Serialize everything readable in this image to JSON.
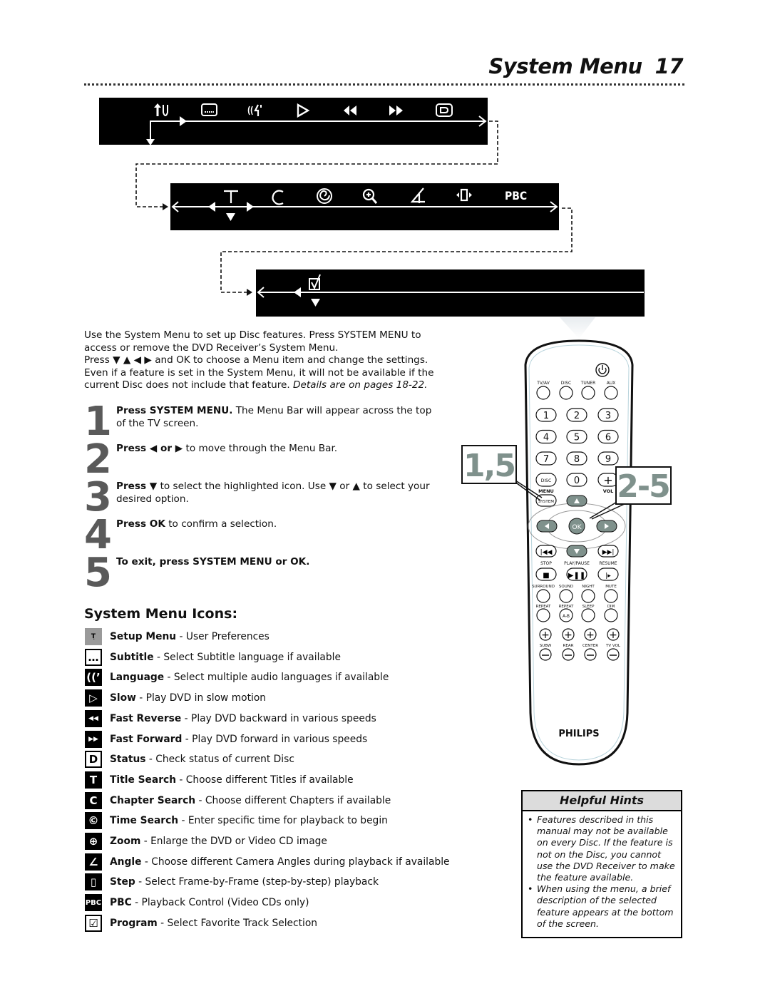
{
  "header": {
    "title": "System Menu",
    "page_number": "17"
  },
  "menu_bars": {
    "bar1": {
      "icons": [
        {
          "name": "setup-icon",
          "glyph": "Tͅ"
        },
        {
          "name": "subtitle-icon",
          "glyph": "▭"
        },
        {
          "name": "language-icon",
          "glyph": "((ᴴ"
        },
        {
          "name": "slow-icon",
          "glyph": "▷"
        },
        {
          "name": "fast-reverse-icon",
          "glyph": "◀◀"
        },
        {
          "name": "fast-forward-icon",
          "glyph": "▶▶"
        },
        {
          "name": "status-icon",
          "glyph": "D"
        }
      ]
    },
    "bar2": {
      "icons": [
        {
          "name": "title-search-icon",
          "glyph": "T"
        },
        {
          "name": "chapter-search-icon",
          "glyph": "C"
        },
        {
          "name": "time-search-icon",
          "glyph": "©"
        },
        {
          "name": "zoom-icon",
          "glyph": "⊕"
        },
        {
          "name": "angle-icon",
          "glyph": "∠"
        },
        {
          "name": "step-icon",
          "glyph": "◂▯▸"
        },
        {
          "name": "pbc-icon",
          "glyph": "PBC"
        }
      ]
    },
    "bar3": {
      "icons": [
        {
          "name": "program-icon",
          "glyph": "☑"
        }
      ]
    }
  },
  "intro": {
    "line1": "Use the System Menu to set up Disc features. Press SYSTEM MENU to access or remove the DVD Receiver’s System Menu.",
    "line2": "Press ▼ ▲ ◀ ▶ and OK to choose a Menu item and change the settings. Even if a feature is set in the System Menu, it will not be available if the current Disc does not include that feature.",
    "details": "Details are on pages 18-22."
  },
  "steps": [
    {
      "number": "1",
      "bold": "Press SYSTEM MENU.",
      "text": " The Menu Bar will appear across the top of the TV screen."
    },
    {
      "number": "2",
      "bold": "Press ◀ or ▶",
      "text": " to move through the Menu Bar."
    },
    {
      "number": "3",
      "bold": "Press ▼",
      "text": " to select the highlighted icon. Use ▼ or ▲  to select your desired option."
    },
    {
      "number": "4",
      "bold": "Press OK",
      "text": " to confirm a selection."
    },
    {
      "number": "5",
      "bold": "To exit, press SYSTEM MENU or OK.",
      "text": ""
    }
  ],
  "icons_section": {
    "title": "System Menu Icons:",
    "items": [
      {
        "glyph": "Tͅ",
        "name": "Setup Menu",
        "desc": " - User Preferences"
      },
      {
        "glyph": "…",
        "name": "Subtitle",
        "desc": " - Select Subtitle language if available"
      },
      {
        "glyph": "((’",
        "name": "Language",
        "desc": " - Select multiple audio languages if available"
      },
      {
        "glyph": "▷",
        "name": "Slow",
        "desc": " - Play DVD in slow motion"
      },
      {
        "glyph": "◀◀",
        "name": "Fast Reverse",
        "desc": " - Play DVD backward in various speeds"
      },
      {
        "glyph": "▶▶",
        "name": "Fast Forward",
        "desc": " - Play DVD forward in various speeds"
      },
      {
        "glyph": "D",
        "name": "Status",
        "desc": " - Check status of current Disc"
      },
      {
        "glyph": "T",
        "name": "Title Search",
        "desc": " - Choose different Titles if available"
      },
      {
        "glyph": "C",
        "name": "Chapter Search",
        "desc": " - Choose different Chapters if available"
      },
      {
        "glyph": "©",
        "name": "Time Search",
        "desc": " - Enter specific time for playback to begin"
      },
      {
        "glyph": "⊕",
        "name": "Zoom",
        "desc": " - Enlarge the DVD or Video CD image"
      },
      {
        "glyph": "∠",
        "name": "Angle",
        "desc": " - Choose different Camera Angles during playback if available"
      },
      {
        "glyph": "▯",
        "name": "Step",
        "desc": " - Select Frame-by-Frame (step-by-step) playback"
      },
      {
        "glyph": "PBC",
        "name": "PBC",
        "desc": " - Playback Control (Video CDs only)"
      },
      {
        "glyph": "☑",
        "name": "Program",
        "desc": " - Select Favorite Track Selection"
      }
    ]
  },
  "remote": {
    "brand": "PHILIPS",
    "source_labels": [
      "TV/AV",
      "DISC",
      "TUNER",
      "AUX"
    ],
    "digits": [
      "1",
      "2",
      "3",
      "4",
      "5",
      "6",
      "7",
      "8",
      "9",
      "0"
    ],
    "disc_menu": "DISC",
    "menu": "MENU",
    "system": "SYSTEM",
    "vol": "VOL",
    "ok": "OK",
    "transport_labels": [
      "STOP",
      "PLAY/PAUSE",
      "RESUME"
    ],
    "row_labels_1": [
      "SURROUND",
      "SOUND",
      "NIGHT",
      "MUTE"
    ],
    "row_labels_2": [
      "REPEAT",
      "REPEAT",
      "SLEEP",
      "DIM"
    ],
    "ab": "A-B",
    "level_labels": [
      "SUBW",
      "REAR",
      "CENTER",
      "TV VOL"
    ],
    "callout_left": "1,5",
    "callout_right": "2-5",
    "callout_color": "#7f918c"
  },
  "hints": {
    "title": "Helpful Hints",
    "items": [
      "Features described in this manual may not be available on every Disc. If the feature is not on the Disc, you cannot use the DVD Receiver to make the feature available.",
      "When using the menu, a brief description of the selected feature appears at the bottom of the screen."
    ]
  }
}
